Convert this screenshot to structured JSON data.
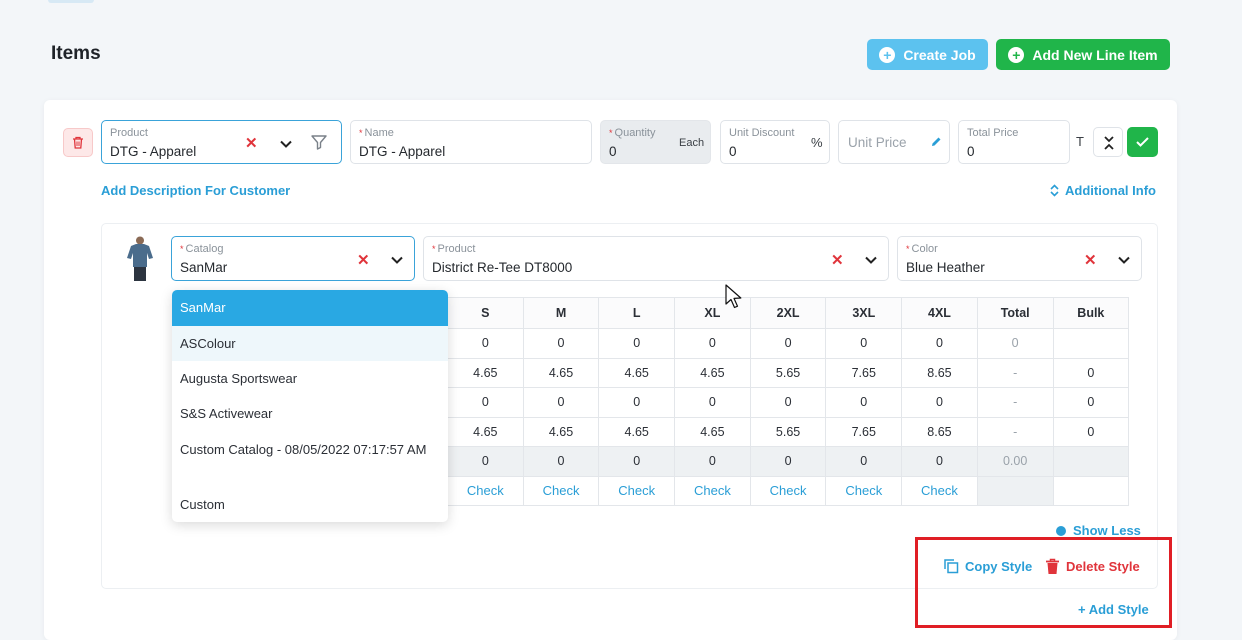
{
  "page": {
    "title": "Items"
  },
  "actions": {
    "create_job": "Create Job",
    "add_line_item": "Add New Line Item"
  },
  "line_item": {
    "product": {
      "label": "Product",
      "value": "DTG - Apparel"
    },
    "name": {
      "label": "Name",
      "value": "DTG - Apparel"
    },
    "quantity": {
      "label": "Quantity",
      "value": "0",
      "unit": "Each"
    },
    "unit_discount": {
      "label": "Unit Discount",
      "value": "0",
      "suffix": "%"
    },
    "unit_price": {
      "placeholder": "Unit Price"
    },
    "total_price": {
      "label": "Total Price",
      "value": "0"
    },
    "t_label": "T",
    "add_description": "Add Description For Customer",
    "additional_info": "Additional Info"
  },
  "style": {
    "catalog": {
      "label": "Catalog",
      "value": "SanMar"
    },
    "product": {
      "label": "Product",
      "value": "District Re-Tee DT8000"
    },
    "color": {
      "label": "Color",
      "value": "Blue Heather"
    },
    "catalog_options": [
      "SanMar",
      "ASColour",
      "Augusta Sportswear",
      "S&S Activewear",
      "Custom Catalog - 08/05/2022 07:17:57 AM",
      "Custom"
    ],
    "sizes": {
      "headers": [
        "S",
        "M",
        "L",
        "XL",
        "2XL",
        "3XL",
        "4XL",
        "Total",
        "Bulk"
      ],
      "rows": [
        [
          "0",
          "0",
          "0",
          "0",
          "0",
          "0",
          "0",
          "0",
          ""
        ],
        [
          "4.65",
          "4.65",
          "4.65",
          "4.65",
          "5.65",
          "7.65",
          "8.65",
          "-",
          "0"
        ],
        [
          "0",
          "0",
          "0",
          "0",
          "0",
          "0",
          "0",
          "-",
          "0"
        ],
        [
          "4.65",
          "4.65",
          "4.65",
          "4.65",
          "5.65",
          "7.65",
          "8.65",
          "-",
          "0"
        ],
        [
          "0",
          "0",
          "0",
          "0",
          "0",
          "0",
          "0",
          "0.00",
          ""
        ],
        [
          "Check",
          "Check",
          "Check",
          "Check",
          "Check",
          "Check",
          "Check",
          "",
          ""
        ]
      ]
    },
    "show_less": "Show Less",
    "copy_style": "Copy Style",
    "delete_style": "Delete Style",
    "add_style": "+ Add Style"
  },
  "colors": {
    "accent": "#2a9ed6",
    "create_job_btn": "#5cc2ef",
    "add_item_btn": "#20b54a",
    "danger": "#e0343b",
    "highlight_box": "#e01e25",
    "selected_option": "#29a8e3"
  }
}
